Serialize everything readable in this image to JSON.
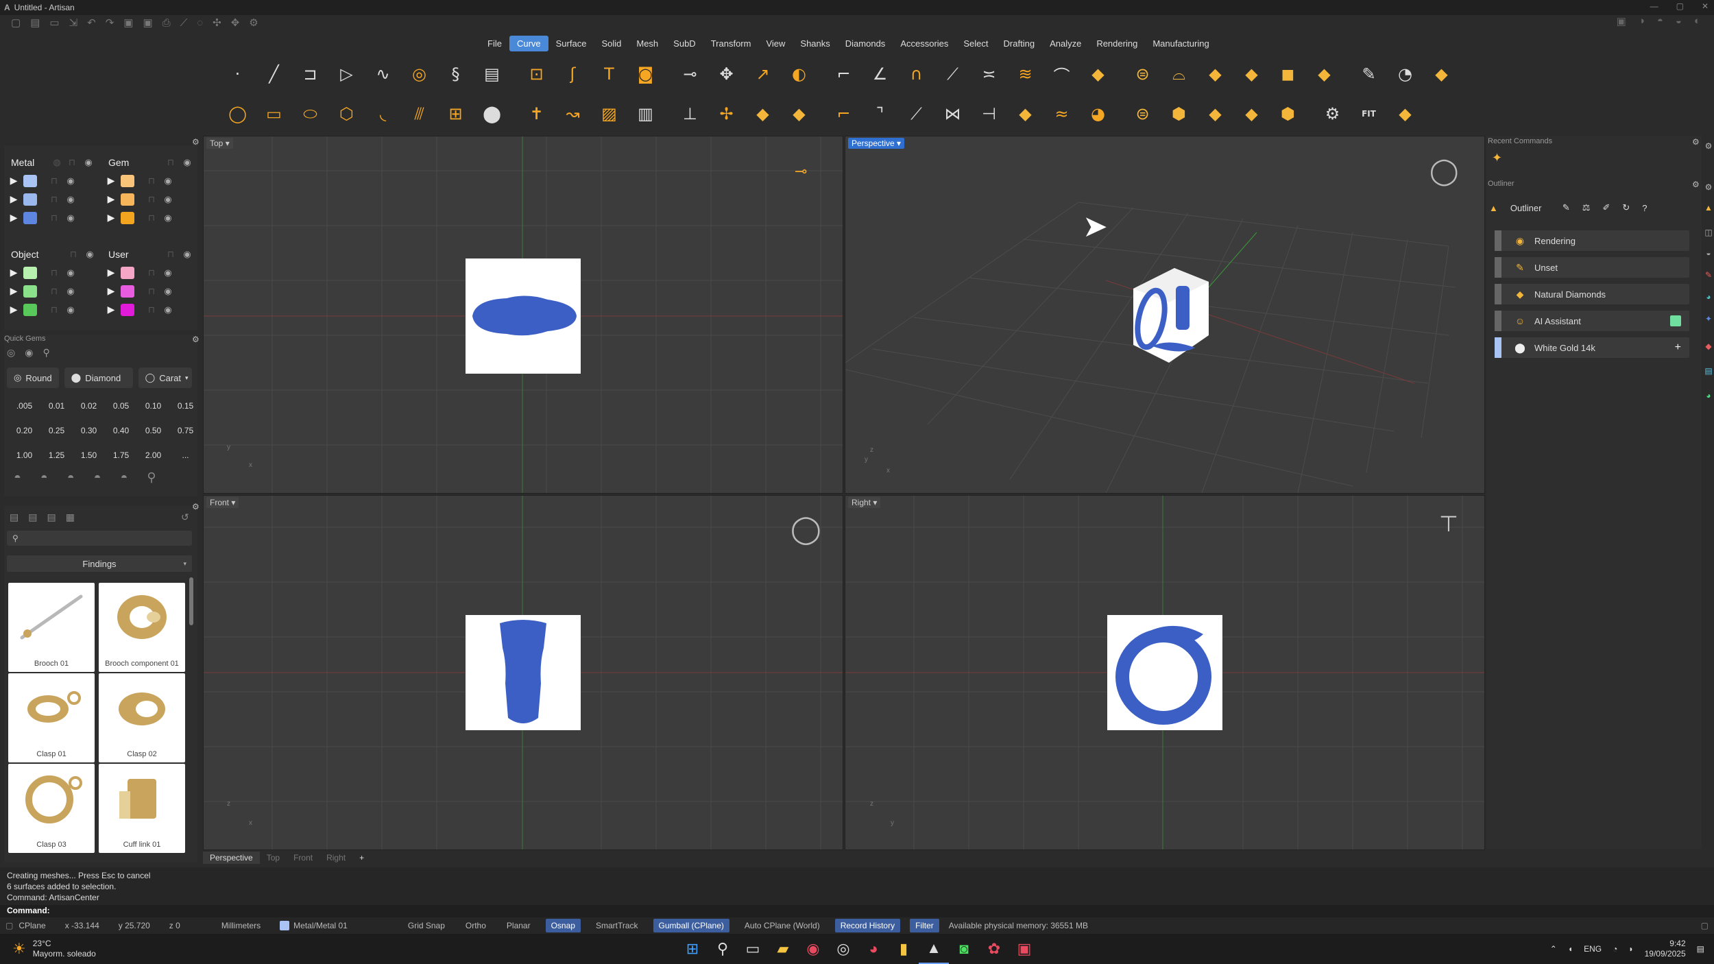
{
  "window": {
    "title": "Untitled - Artisan",
    "logo": "A",
    "controls": [
      "—",
      "▢",
      "✕"
    ]
  },
  "menus": [
    {
      "label": "File"
    },
    {
      "label": "Curve",
      "active": true
    },
    {
      "label": "Surface"
    },
    {
      "label": "Solid"
    },
    {
      "label": "Mesh"
    },
    {
      "label": "SubD"
    },
    {
      "label": "Transform"
    },
    {
      "label": "View"
    },
    {
      "label": "Shanks"
    },
    {
      "label": "Diamonds"
    },
    {
      "label": "Accessories"
    },
    {
      "label": "Select"
    },
    {
      "label": "Drafting"
    },
    {
      "label": "Analyze"
    },
    {
      "label": "Rendering"
    },
    {
      "label": "Manufacturing"
    }
  ],
  "toolbar": {
    "row1": [
      {
        "icon": "point-icon",
        "glyph": "·",
        "c": "w"
      },
      {
        "icon": "line-icon",
        "glyph": "╱",
        "c": "w"
      },
      {
        "icon": "polyline-icon",
        "glyph": "⊐",
        "c": "w"
      },
      {
        "icon": "triangle-curve-icon",
        "glyph": "▷",
        "c": "w"
      },
      {
        "icon": "spline-icon",
        "glyph": "∿",
        "c": "w"
      },
      {
        "icon": "spiral-icon",
        "glyph": "◎",
        "c": "o"
      },
      {
        "icon": "helix-icon",
        "glyph": "§",
        "c": "w"
      },
      {
        "icon": "project-curve-icon",
        "glyph": "▤",
        "c": "w"
      },
      {
        "sep": true
      },
      {
        "icon": "curve-from-object-icon",
        "glyph": "⊡",
        "c": "o"
      },
      {
        "icon": "freeform-icon",
        "glyph": "ʃ",
        "c": "o"
      },
      {
        "icon": "text-icon",
        "glyph": "T",
        "c": "o"
      },
      {
        "icon": "image-trace-icon",
        "glyph": "◙",
        "c": "o"
      },
      {
        "sep": true
      },
      {
        "icon": "split-icon",
        "glyph": "⊸",
        "c": "w"
      },
      {
        "icon": "explode-icon",
        "glyph": "✥",
        "c": "w"
      },
      {
        "icon": "extend-icon",
        "glyph": "↗",
        "c": "o"
      },
      {
        "icon": "offset-icon",
        "glyph": "◐",
        "c": "o"
      },
      {
        "sep": true
      },
      {
        "icon": "fillet-curve-icon",
        "glyph": "⌐",
        "c": "w"
      },
      {
        "icon": "blend-curve-icon",
        "glyph": "∠",
        "c": "w"
      },
      {
        "icon": "arch-icon",
        "glyph": "∩",
        "c": "o"
      },
      {
        "icon": "curve-end-icon",
        "glyph": "⟋",
        "c": "w"
      },
      {
        "icon": "join-curve-icon",
        "glyph": "≍",
        "c": "w"
      },
      {
        "icon": "offset-curves-icon",
        "glyph": "≋",
        "c": "o"
      },
      {
        "icon": "rebuild-curve-icon",
        "glyph": "⌒",
        "c": "w"
      },
      {
        "icon": "pipe-icon",
        "glyph": "◆",
        "c": "y"
      },
      {
        "sep": true
      },
      {
        "icon": "shank-icon",
        "glyph": "⊜",
        "c": "y"
      },
      {
        "icon": "bend-icon",
        "glyph": "⌓",
        "c": "y"
      },
      {
        "icon": "surface-icon",
        "glyph": "◆",
        "c": "y"
      },
      {
        "icon": "loft-icon",
        "glyph": "◆",
        "c": "y"
      },
      {
        "icon": "box-icon",
        "glyph": "◼",
        "c": "y"
      },
      {
        "icon": "sweep-icon",
        "glyph": "◆",
        "c": "y"
      },
      {
        "sep": true
      },
      {
        "icon": "brush-icon",
        "glyph": "✎",
        "c": "w"
      },
      {
        "icon": "gauge-icon",
        "glyph": "◔",
        "c": "w"
      },
      {
        "icon": "panel-icon",
        "glyph": "◆",
        "c": "y"
      }
    ],
    "row2": [
      {
        "icon": "circle-icon",
        "glyph": "◯",
        "c": "o"
      },
      {
        "icon": "rectangle-icon",
        "glyph": "▭",
        "c": "o"
      },
      {
        "icon": "ellipse-icon",
        "glyph": "⬭",
        "c": "o"
      },
      {
        "icon": "polygon-icon",
        "glyph": "⬡",
        "c": "o"
      },
      {
        "icon": "arc-icon",
        "glyph": "◟",
        "c": "o"
      },
      {
        "icon": "curve-network-icon",
        "glyph": "⫻",
        "c": "o"
      },
      {
        "icon": "grid-curve-icon",
        "glyph": "⊞",
        "c": "o"
      },
      {
        "icon": "sphere-icon",
        "glyph": "⬤",
        "c": "w"
      },
      {
        "sep": true
      },
      {
        "icon": "mirror-icon",
        "glyph": "✝",
        "c": "o"
      },
      {
        "icon": "flow-icon",
        "glyph": "↝",
        "c": "o"
      },
      {
        "icon": "picture-icon",
        "glyph": "▨",
        "c": "o"
      },
      {
        "icon": "gallery-icon",
        "glyph": "▥",
        "c": "w"
      },
      {
        "sep": true
      },
      {
        "icon": "trim-icon",
        "glyph": "⊥",
        "c": "w"
      },
      {
        "icon": "join-icon",
        "glyph": "✢",
        "c": "o"
      },
      {
        "icon": "planar-icon",
        "glyph": "◆",
        "c": "y"
      },
      {
        "icon": "extrude-icon",
        "glyph": "◆",
        "c": "y"
      },
      {
        "sep": true
      },
      {
        "icon": "chamfer-curve-icon",
        "glyph": "⌐",
        "c": "o"
      },
      {
        "icon": "corner-icon",
        "glyph": "⌝",
        "c": "w"
      },
      {
        "icon": "smooth-icon",
        "glyph": "⟋",
        "c": "w"
      },
      {
        "icon": "symmetry-icon",
        "glyph": "⋈",
        "c": "w"
      },
      {
        "icon": "match-curve-icon",
        "glyph": "⊣",
        "c": "w"
      },
      {
        "icon": "patch-icon",
        "glyph": "◆",
        "c": "y"
      },
      {
        "icon": "wave-icon",
        "glyph": "≈",
        "c": "o"
      },
      {
        "icon": "bezier-icon",
        "glyph": "◕",
        "c": "o"
      },
      {
        "sep": true
      },
      {
        "icon": "band-icon",
        "glyph": "⊜",
        "c": "y"
      },
      {
        "icon": "gem-cut-icon",
        "glyph": "⬢",
        "c": "y"
      },
      {
        "icon": "surface-patch-icon",
        "glyph": "◆",
        "c": "y"
      },
      {
        "icon": "network-surface-icon",
        "glyph": "◆",
        "c": "y"
      },
      {
        "icon": "solid-box-icon",
        "glyph": "⬢",
        "c": "y"
      },
      {
        "sep": true
      },
      {
        "icon": "setter-icon",
        "glyph": "⚙",
        "c": "w"
      },
      {
        "icon": "fit-icon",
        "glyph": "FIT",
        "c": "w"
      },
      {
        "icon": "rail-icon",
        "glyph": "◆",
        "c": "y"
      }
    ]
  },
  "layers": {
    "metal": {
      "title": "Metal",
      "colors": [
        "#a9c3f5",
        "#9ab8ee",
        "#5e86e0"
      ]
    },
    "gem": {
      "title": "Gem",
      "colors": [
        "#f9c37a",
        "#f6b55b",
        "#f4a51f"
      ]
    },
    "object": {
      "title": "Object",
      "colors": [
        "#b8f0b0",
        "#8be08a",
        "#58c85a"
      ]
    },
    "user": {
      "title": "User",
      "colors": [
        "#f5a6c7",
        "#e85ce0",
        "#e21ad9"
      ]
    }
  },
  "quick_gems": {
    "title": "Quick Gems",
    "shape": "Round",
    "material": "Diamond",
    "mode": "Carat",
    "values": [
      ".005",
      "0.01",
      "0.02",
      "0.05",
      "0.10",
      "0.15",
      "0.20",
      "0.25",
      "0.30",
      "0.40",
      "0.50",
      "0.75",
      "1.00",
      "1.25",
      "1.50",
      "1.75",
      "2.00",
      "..."
    ]
  },
  "findings": {
    "search_placeholder": "",
    "category": "Findings",
    "items": [
      {
        "label": "Brooch 01"
      },
      {
        "label": "Brooch component 01"
      },
      {
        "label": "Clasp 01"
      },
      {
        "label": "Clasp 02"
      },
      {
        "label": "Clasp 03"
      },
      {
        "label": "Cuff link 01"
      }
    ]
  },
  "viewports": {
    "top": {
      "label": "Top"
    },
    "perspective": {
      "label": "Perspective"
    },
    "front": {
      "label": "Front"
    },
    "right": {
      "label": "Right"
    },
    "tabs": [
      "Perspective",
      "Top",
      "Front",
      "Right",
      "+"
    ],
    "axes": {
      "top": [
        "y",
        "x"
      ],
      "perspective": [
        "z",
        "y",
        "x"
      ],
      "front": [
        "z",
        "x"
      ],
      "right": [
        "z",
        "y"
      ]
    }
  },
  "right_panel": {
    "recent_title": "Recent Commands",
    "outliner_title": "Outliner",
    "outliner_label": "Outliner",
    "rows": [
      {
        "label": "Rendering",
        "icon": "palette-icon"
      },
      {
        "label": "Unset",
        "icon": "brush-icon"
      },
      {
        "label": "Natural Diamonds",
        "icon": "diamond-icon"
      },
      {
        "label": "AI Assistant",
        "icon": "ai-icon",
        "accent": "#6fe0a0"
      },
      {
        "label": "White Gold 14k",
        "icon": "sphere-icon",
        "extra": "+"
      }
    ]
  },
  "console": {
    "lines": [
      "Creating meshes... Press Esc to cancel",
      "6 surfaces added to selection.",
      "Command: ArtisanCenter"
    ],
    "prompt": "Command:"
  },
  "status": {
    "cplane": "CPlane",
    "x": "x -33.144",
    "y": "y 25.720",
    "z": "z 0",
    "units": "Millimeters",
    "layer": "Metal/Metal 01",
    "toggles": [
      {
        "label": "Grid Snap",
        "on": false
      },
      {
        "label": "Ortho",
        "on": false
      },
      {
        "label": "Planar",
        "on": false
      },
      {
        "label": "Osnap",
        "on": true
      },
      {
        "label": "SmartTrack",
        "on": false
      },
      {
        "label": "Gumball (CPlane)",
        "on": true
      },
      {
        "label": "Auto CPlane (World)",
        "on": false
      },
      {
        "label": "Record History",
        "on": true
      },
      {
        "label": "Filter",
        "on": true
      }
    ],
    "memory": "Available physical memory: 36551 MB"
  },
  "taskbar": {
    "weather_temp": "23°C",
    "weather_desc": "Mayorm. soleado",
    "lang": "ENG",
    "time": "9:42",
    "date": "19/09/2025"
  }
}
